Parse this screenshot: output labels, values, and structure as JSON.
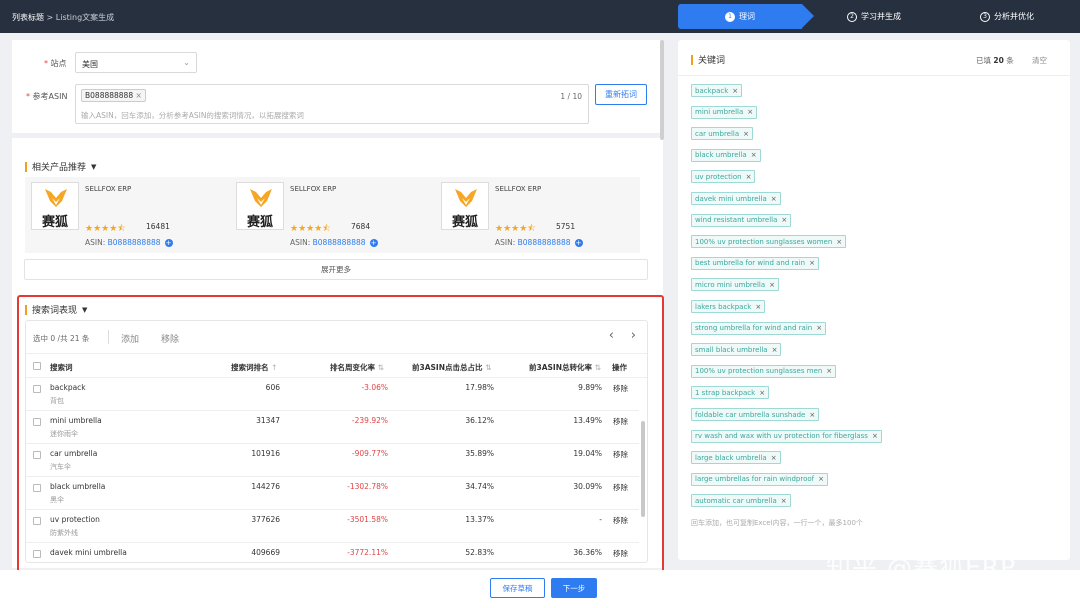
{
  "breadcrumb": {
    "root": "列表标题",
    "sep": " > ",
    "current": "Listing文案生成"
  },
  "steps": [
    {
      "num": "1",
      "label": "理词"
    },
    {
      "num": "2",
      "label": "学习并生成"
    },
    {
      "num": "3",
      "label": "分析并优化"
    }
  ],
  "form": {
    "site_label": "站点",
    "site_value": "美国",
    "asin_label": "参考ASIN",
    "asin_chip": "B088888888",
    "asin_counter": "1 / 10",
    "asin_placeholder": "输入ASIN，回车添加，分析参考ASIN的搜索词情况，以拓展搜索词",
    "reexpand_button": "重新拓词"
  },
  "similar": {
    "title": "相关产品推荐",
    "products": [
      {
        "logo_text": "赛狐",
        "brand": "SELLFOX ERP",
        "rating_stars": "★★★★⯪",
        "rating": 4.5,
        "reviews": "16481",
        "asin_label": "ASIN:",
        "asin": "B0888888888"
      },
      {
        "logo_text": "赛狐",
        "brand": "SELLFOX ERP",
        "rating_stars": "★★★★⯪",
        "rating": 4.5,
        "reviews": "7684",
        "asin_label": "ASIN:",
        "asin": "B0888888888"
      },
      {
        "logo_text": "赛狐",
        "brand": "SELLFOX ERP",
        "rating_stars": "★★★★⯪",
        "rating": 4.5,
        "reviews": "5751",
        "asin_label": "ASIN:",
        "asin": "B0888888888"
      }
    ],
    "show_more": "展开更多"
  },
  "search_terms": {
    "title": "搜索词表现",
    "selection": "选中 0 /共 21 条",
    "add": "添加",
    "remove": "移除",
    "columns": [
      "搜索词",
      "搜索词排名",
      "排名周变化率",
      "前3ASIN点击总占比",
      "前3ASIN总转化率",
      "操作"
    ],
    "sort_icons": [
      "↑",
      "⇅",
      "⇅",
      "⇅"
    ],
    "rows": [
      {
        "term": "backpack",
        "cn": "背包",
        "rank": "606",
        "change": "-3.06%",
        "click": "17.98%",
        "conv": "9.89%",
        "op": "移除"
      },
      {
        "term": "mini umbrella",
        "cn": "迷你雨伞",
        "rank": "31347",
        "change": "-239.92%",
        "click": "36.12%",
        "conv": "13.49%",
        "op": "移除"
      },
      {
        "term": "car umbrella",
        "cn": "汽车伞",
        "rank": "101916",
        "change": "-909.77%",
        "click": "35.89%",
        "conv": "19.04%",
        "op": "移除"
      },
      {
        "term": "black umbrella",
        "cn": "黑伞",
        "rank": "144276",
        "change": "-1302.78%",
        "click": "34.74%",
        "conv": "30.09%",
        "op": "移除"
      },
      {
        "term": "uv protection",
        "cn": "防紫外线",
        "rank": "377626",
        "change": "-3501.58%",
        "click": "13.37%",
        "conv": "-",
        "op": "移除"
      },
      {
        "term": "davek mini umbrella",
        "cn": "",
        "rank": "409669",
        "change": "-3772.11%",
        "click": "52.83%",
        "conv": "36.36%",
        "op": "移除"
      }
    ]
  },
  "keywords": {
    "title": "关键词",
    "filled_prefix": "已填",
    "filled_count": "20",
    "filled_suffix": "条",
    "clear": "清空",
    "items": [
      "backpack",
      "mini umbrella",
      "car umbrella",
      "black umbrella",
      "uv protection",
      "davek mini umbrella",
      "wind resistant umbrella",
      "100% uv protection sunglasses women",
      "best umbrella for wind and rain",
      "micro mini umbrella",
      "lakers backpack",
      "strong umbrella for wind and rain",
      "small black umbrella",
      "100% uv protection sunglasses men",
      "1 strap backpack",
      "foldable car umbrella sunshade",
      "rv wash and wax with uv protection for fiberglass",
      "large black umbrella",
      "large umbrellas for rain windproof",
      "automatic car umbrella"
    ],
    "hint": "回车添加，也可复制Excel内容，一行一个，最多100个"
  },
  "footer": {
    "save": "保存草稿",
    "next": "下一步"
  },
  "watermark": "知乎 @赛狐ERP",
  "colors": {
    "primary": "#2f7cf0",
    "topbar": "#27303f",
    "negative": "#e04545",
    "keyword": "#3aa99f",
    "highlight_box": "#e53935",
    "star": "#f5a623"
  }
}
